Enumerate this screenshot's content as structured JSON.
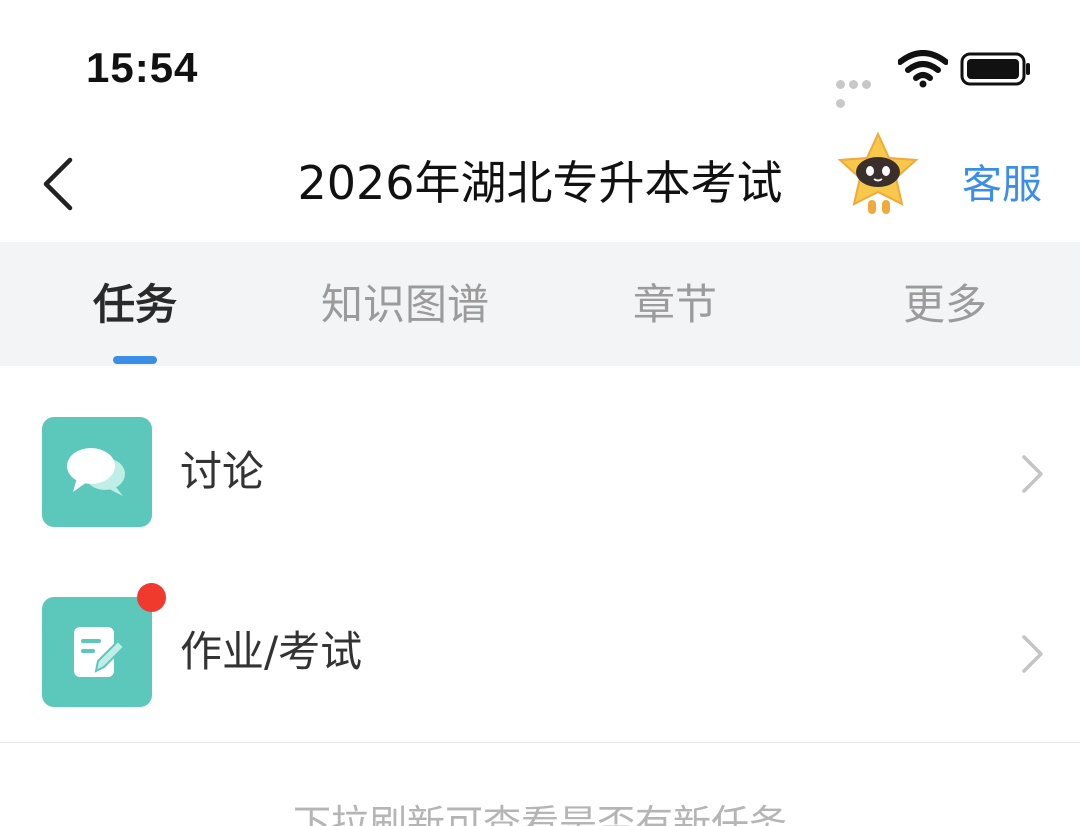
{
  "status_bar": {
    "time": "15:54"
  },
  "nav": {
    "title": "2026年湖北专升本考试",
    "service_label": "客服"
  },
  "tabs": [
    {
      "label": "任务",
      "active": true
    },
    {
      "label": "知识图谱",
      "active": false
    },
    {
      "label": "章节",
      "active": false
    },
    {
      "label": "更多",
      "active": false
    }
  ],
  "list": [
    {
      "label": "讨论",
      "icon": "chat-bubbles-icon",
      "has_badge": false
    },
    {
      "label": "作业/考试",
      "icon": "edit-document-icon",
      "has_badge": true
    }
  ],
  "footer_hint": "下拉刷新可查看是否有新任务",
  "colors": {
    "accent": "#3b8ee8",
    "icon_bg": "#5cc8bb",
    "badge": "#f03a2e",
    "tab_bar_bg": "#f3f4f6"
  }
}
